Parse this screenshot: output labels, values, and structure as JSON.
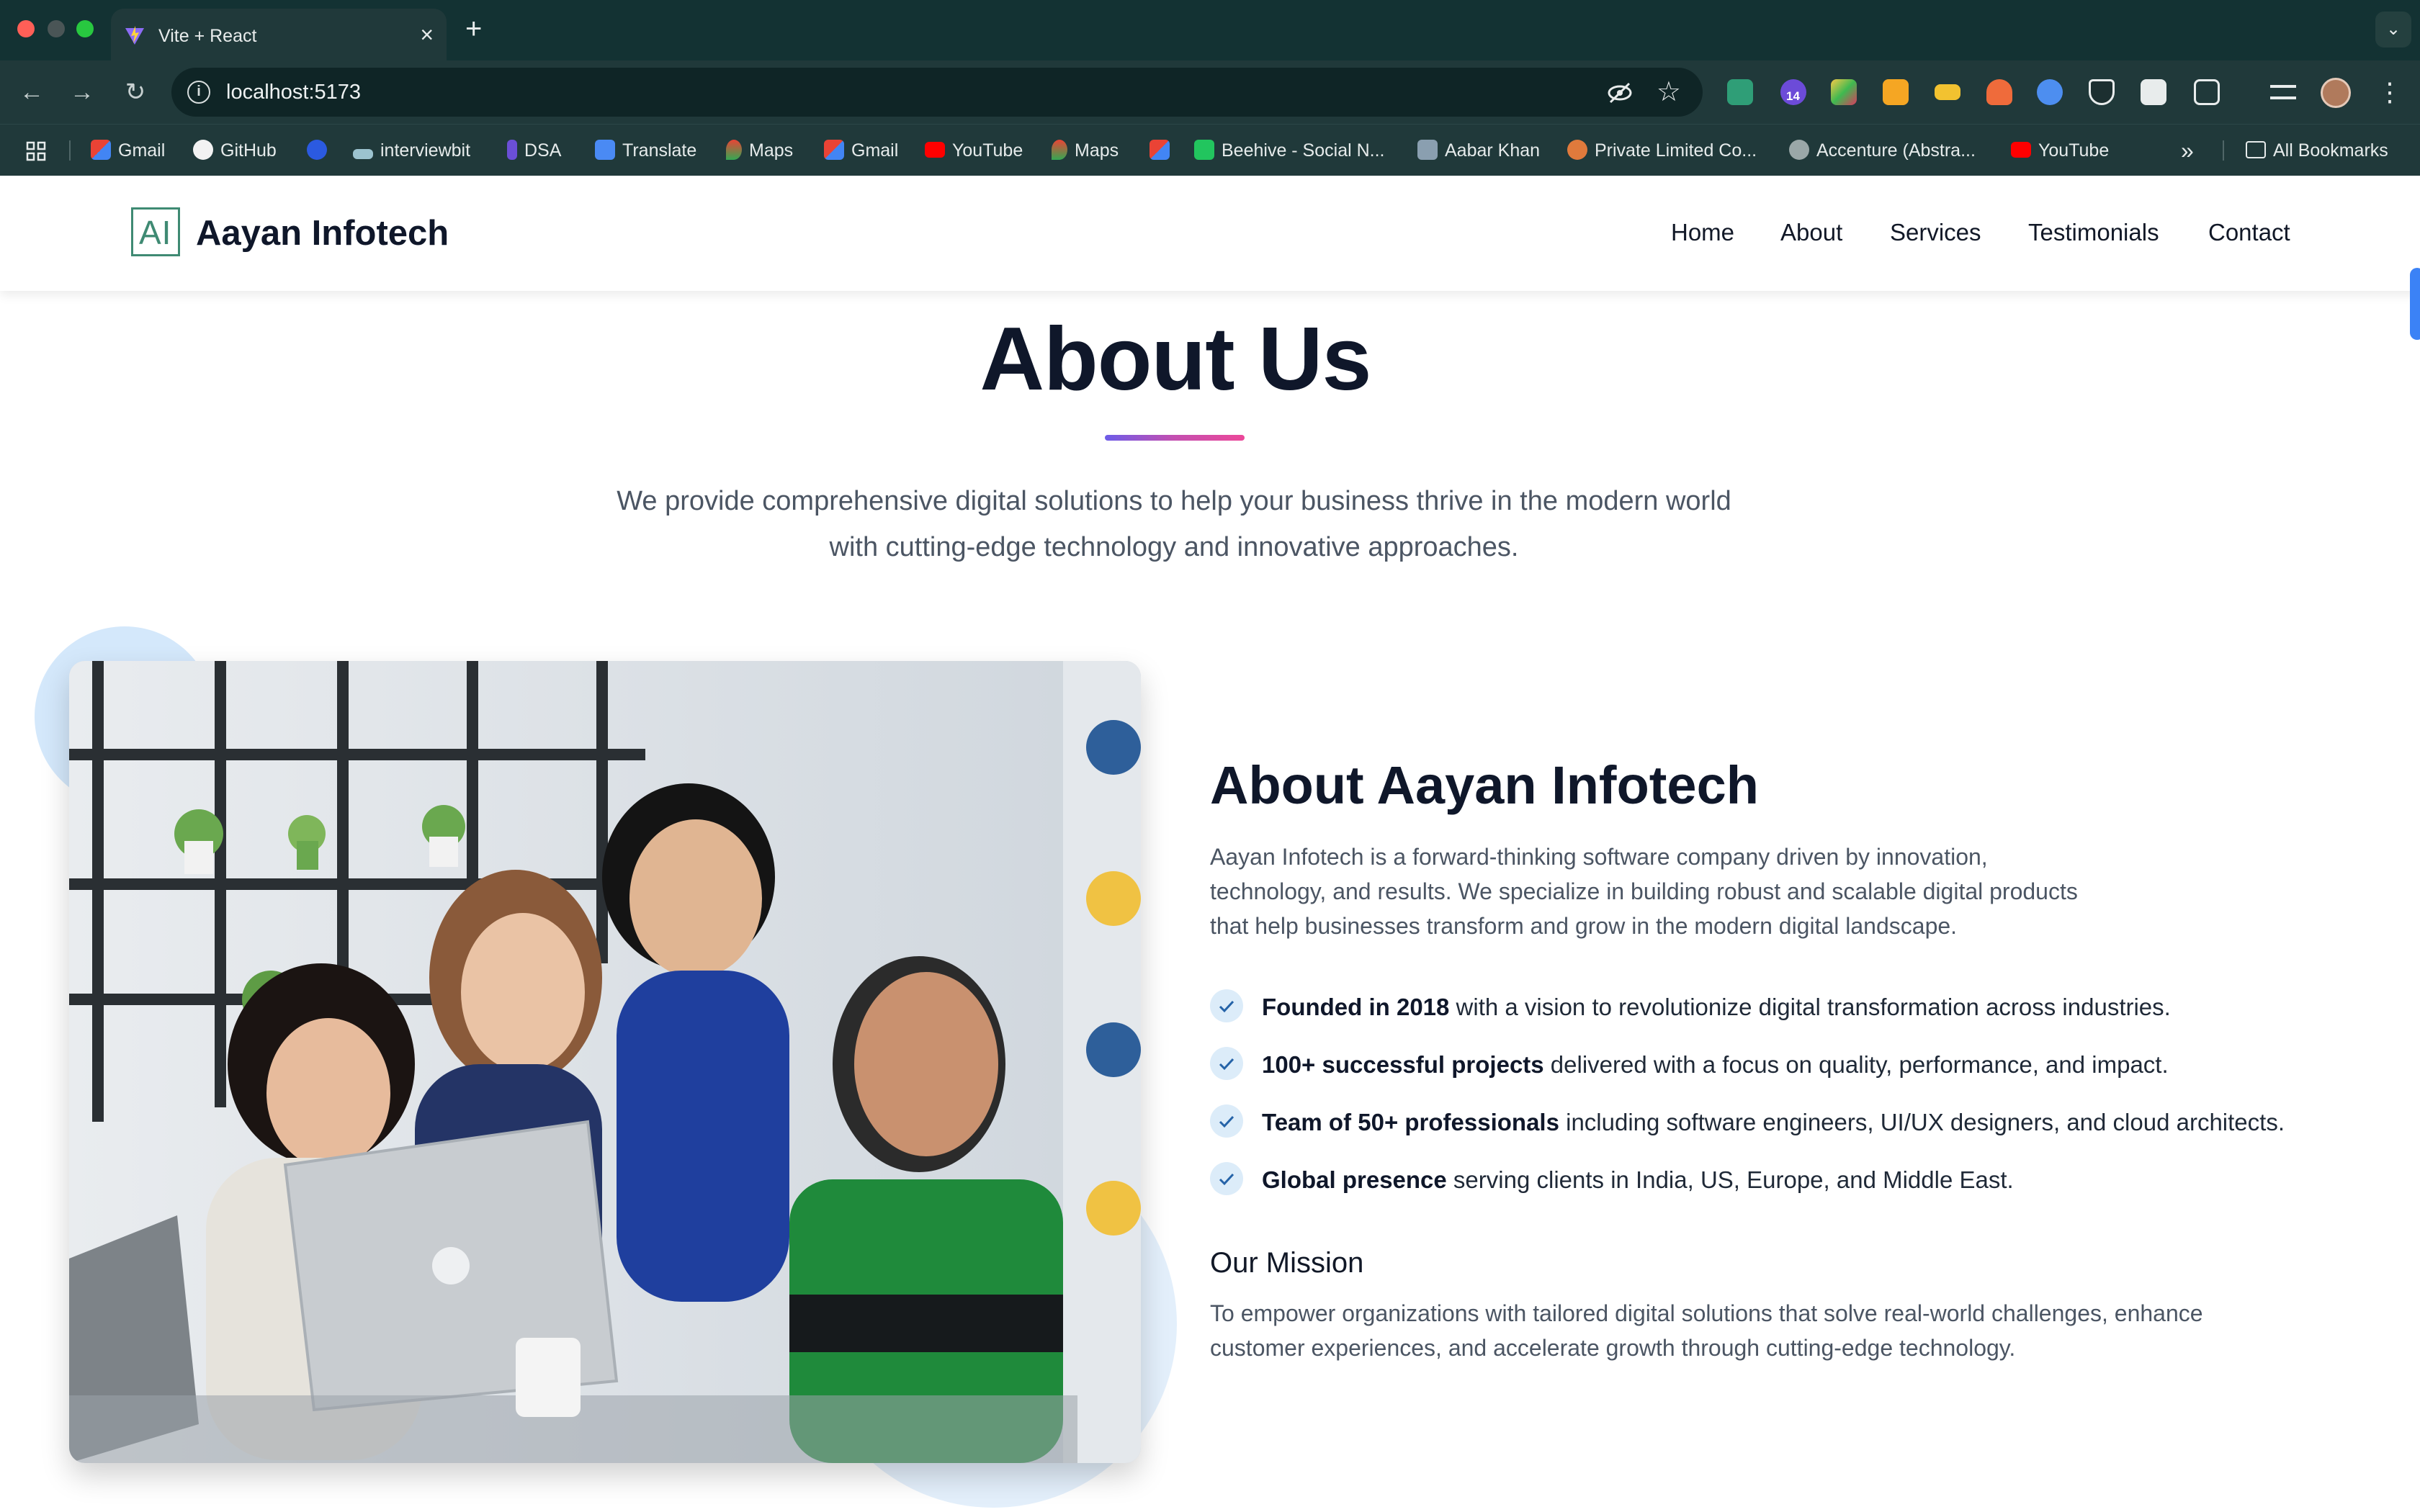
{
  "browser": {
    "tab_title": "Vite + React",
    "url": "localhost:5173",
    "extension_badge": "14",
    "bookmarks": [
      {
        "label": "Gmail",
        "icon": "gmail-icon"
      },
      {
        "label": "GitHub",
        "icon": "github-icon"
      },
      {
        "label": "",
        "icon": "c-icon"
      },
      {
        "label": "interviewbit",
        "icon": "interviewbit-icon"
      },
      {
        "label": "DSA",
        "icon": "dsa-icon"
      },
      {
        "label": "Translate",
        "icon": "translate-icon"
      },
      {
        "label": "Maps",
        "icon": "maps-icon"
      },
      {
        "label": "Gmail",
        "icon": "gmail-icon"
      },
      {
        "label": "YouTube",
        "icon": "youtube-icon"
      },
      {
        "label": "Maps",
        "icon": "maps-icon"
      },
      {
        "label": "",
        "icon": "gmail-icon"
      },
      {
        "label": "Beehive - Social N...",
        "icon": "beehive-icon"
      },
      {
        "label": "Aabar Khan",
        "icon": "person-icon"
      },
      {
        "label": "Private Limited Co...",
        "icon": "company-icon"
      },
      {
        "label": "Accenture (Abstra...",
        "icon": "globe-icon"
      },
      {
        "label": "YouTube",
        "icon": "youtube-icon"
      }
    ],
    "all_bookmarks": "All Bookmarks",
    "more_bookmarks": "»"
  },
  "site": {
    "logo_text": "AI",
    "brand": "Aayan Infotech",
    "nav": [
      "Home",
      "About",
      "Services",
      "Testimonials",
      "Contact"
    ]
  },
  "about": {
    "title": "About Us",
    "intro": "We provide comprehensive digital solutions to help your business thrive in the modern world with cutting-edge technology and innovative approaches.",
    "heading": "About Aayan Infotech",
    "description": "Aayan Infotech is a forward-thinking software company driven by innovation, technology, and results. We specialize in building robust and scalable digital products that help businesses transform and grow in the modern digital landscape.",
    "features": [
      {
        "bold": "Founded in 2018",
        "text": " with a vision to revolutionize digital transformation across industries."
      },
      {
        "bold": "100+ successful projects",
        "text": " delivered with a focus on quality, performance, and impact."
      },
      {
        "bold": "Team of 50+ professionals",
        "text": " including software engineers, UI/UX designers, and cloud architects."
      },
      {
        "bold": "Global presence",
        "text": " serving clients in India, US, Europe, and Middle East."
      }
    ],
    "mission_title": "Our Mission",
    "mission_text": "To empower organizations with tailored digital solutions that solve real-world challenges, enhance customer experiences, and accelerate growth through cutting-edge technology."
  },
  "colors": {
    "browser_bg": "#133233",
    "accent_gradient": [
      "#6d5ce8",
      "#ec4899"
    ],
    "heading": "#0f172a",
    "body_text": "#4b5563",
    "logo_green": "#3f8a73"
  }
}
